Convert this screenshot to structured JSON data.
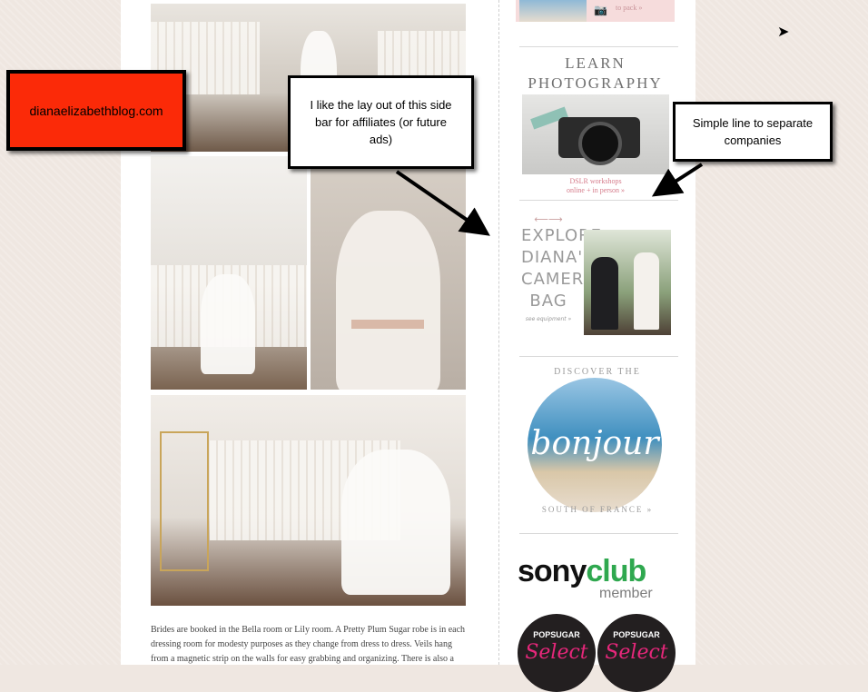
{
  "site_label": "dianaelizabethblog.com",
  "annotations": {
    "sidebar_note": "I like the lay out of this side bar for affiliates (or future ads)",
    "line_note": "Simple line to separate companies"
  },
  "post_text": "Brides are booked in the Bella room or Lily room.  A Pretty Plum Sugar robe is in each dressing room for modesty purposes as they change from dress to dress.  Veils hang from a magnetic strip on the walls for easy grabbing and organizing.  There is also a",
  "sidebar": {
    "top_ad_text": "to pack »",
    "learn_line1": "LEARN",
    "learn_line2": "PHOTOGRAPHY",
    "dslr_line1": "DSLR workshops",
    "dslr_line2": "online + in person »",
    "explore_words": [
      "EXPLORE",
      "DIANA'S",
      "CAMERA",
      "BAG"
    ],
    "see_equipment": "see equipment »",
    "discover": "DISCOVER THE",
    "bonjour": "bonjour",
    "south": "SOUTH OF FRANCE »",
    "sony_word": "sony",
    "club_word": "club",
    "member": "member",
    "popsugar_label": "POPSUGAR",
    "select_label": "Select"
  },
  "colors": {
    "red_box": "#fb2a08",
    "sony_green": "#2fa84f",
    "popsugar_pink": "#e6277a"
  }
}
